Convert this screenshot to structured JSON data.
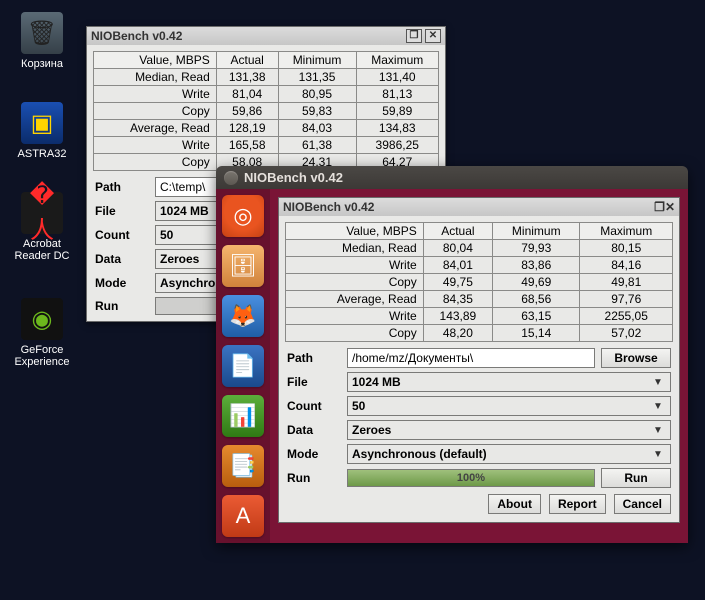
{
  "desktop": {
    "trash_label": "Корзина",
    "astra_label": "ASTRA32",
    "acrobat_label": "Acrobat Reader DC",
    "geforce_label": "GeForce Experience"
  },
  "win1": {
    "title": "NIOBench v0.42",
    "table": {
      "headers": [
        "Value, MBPS",
        "Actual",
        "Minimum",
        "Maximum"
      ],
      "rows": [
        [
          "Median, Read",
          "131,38",
          "131,35",
          "131,40"
        ],
        [
          "Write",
          "81,04",
          "80,95",
          "81,13"
        ],
        [
          "Copy",
          "59,86",
          "59,83",
          "59,89"
        ],
        [
          "Average, Read",
          "128,19",
          "84,03",
          "134,83"
        ],
        [
          "Write",
          "165,58",
          "61,38",
          "3986,25"
        ],
        [
          "Copy",
          "58,08",
          "24,31",
          "64,27"
        ]
      ]
    },
    "form": {
      "path_label": "Path",
      "path_value": "C:\\temp\\",
      "file_label": "File",
      "file_value": "1024 MB",
      "count_label": "Count",
      "count_value": "50",
      "data_label": "Data",
      "data_value": "Zeroes",
      "mode_label": "Mode",
      "mode_value": "Asynchro",
      "run_label": "Run"
    }
  },
  "ubuntu": {
    "title": "NIOBench v0.42"
  },
  "win2": {
    "title": "NIOBench v0.42",
    "table": {
      "headers": [
        "Value, MBPS",
        "Actual",
        "Minimum",
        "Maximum"
      ],
      "rows": [
        [
          "Median, Read",
          "80,04",
          "79,93",
          "80,15"
        ],
        [
          "Write",
          "84,01",
          "83,86",
          "84,16"
        ],
        [
          "Copy",
          "49,75",
          "49,69",
          "49,81"
        ],
        [
          "Average, Read",
          "84,35",
          "68,56",
          "97,76"
        ],
        [
          "Write",
          "143,89",
          "63,15",
          "2255,05"
        ],
        [
          "Copy",
          "48,20",
          "15,14",
          "57,02"
        ]
      ]
    },
    "form": {
      "path_label": "Path",
      "path_value": "/home/mz/Документы\\",
      "browse": "Browse",
      "file_label": "File",
      "file_value": "1024 MB",
      "count_label": "Count",
      "count_value": "50",
      "data_label": "Data",
      "data_value": "Zeroes",
      "mode_label": "Mode",
      "mode_value": "Asynchronous (default)",
      "run_label": "Run",
      "run_button": "Run",
      "progress": "100%",
      "about": "About",
      "report": "Report",
      "cancel": "Cancel"
    }
  }
}
